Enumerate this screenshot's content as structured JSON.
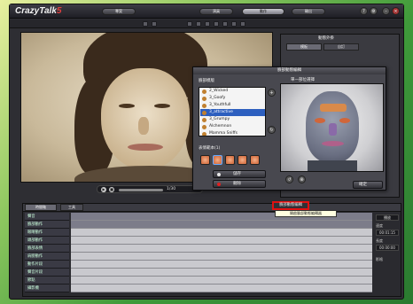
{
  "app": {
    "title_main": "CrazyTalk",
    "title_suffix": "5"
  },
  "main_tabs": [
    {
      "label": "專案"
    },
    {
      "label": "演員"
    },
    {
      "label": "動作"
    },
    {
      "label": "輸出"
    }
  ],
  "window_buttons": {
    "help": "?",
    "settings": "⚙",
    "minimize": "–",
    "close": "×"
  },
  "right_panel": {
    "header": "動態外掛",
    "tabs": [
      "模板",
      "自訂"
    ]
  },
  "dialog": {
    "title": "臉部動態編輯",
    "preset_section": "臉部模版",
    "presets": [
      {
        "label": "2_Wicked",
        "selected": false
      },
      {
        "label": "3_Goofy",
        "selected": false
      },
      {
        "label": "3_YouthfulI",
        "selected": false
      },
      {
        "label": "3_attractive",
        "selected": true
      },
      {
        "label": "3_Grumpy",
        "selected": false
      },
      {
        "label": "Alchemnon",
        "selected": false
      },
      {
        "label": "Mamma Sniffs",
        "selected": false
      }
    ],
    "expression_section": "表情範本(1)",
    "preview_header": "單一部位選擇",
    "button_save": "儲存",
    "button_delete": "刪除",
    "preview_ok": "確定"
  },
  "viewport": {
    "counter": "1/30"
  },
  "timeline": {
    "tab_main": "時間軸",
    "tab_second": "工具",
    "tracks": [
      "聲音",
      "臉部動作",
      "眼睛動作",
      "頭部動作",
      "臉部表情",
      "肩膀動作",
      "動作片段",
      "聲音片段",
      "節點",
      "攝影機"
    ],
    "highlight_button": "臉部動態編輯",
    "tooltip": "開啟臉部動態編輯器",
    "right_button_1": "播放",
    "time_value_1": "00:01:15",
    "time_value_2": "00:00:00",
    "side_labels": [
      "速度",
      "長度",
      "影格"
    ]
  },
  "icons": [
    "help-icon",
    "settings-icon",
    "minimize-icon",
    "close-icon",
    "play-icon",
    "stop-icon"
  ]
}
